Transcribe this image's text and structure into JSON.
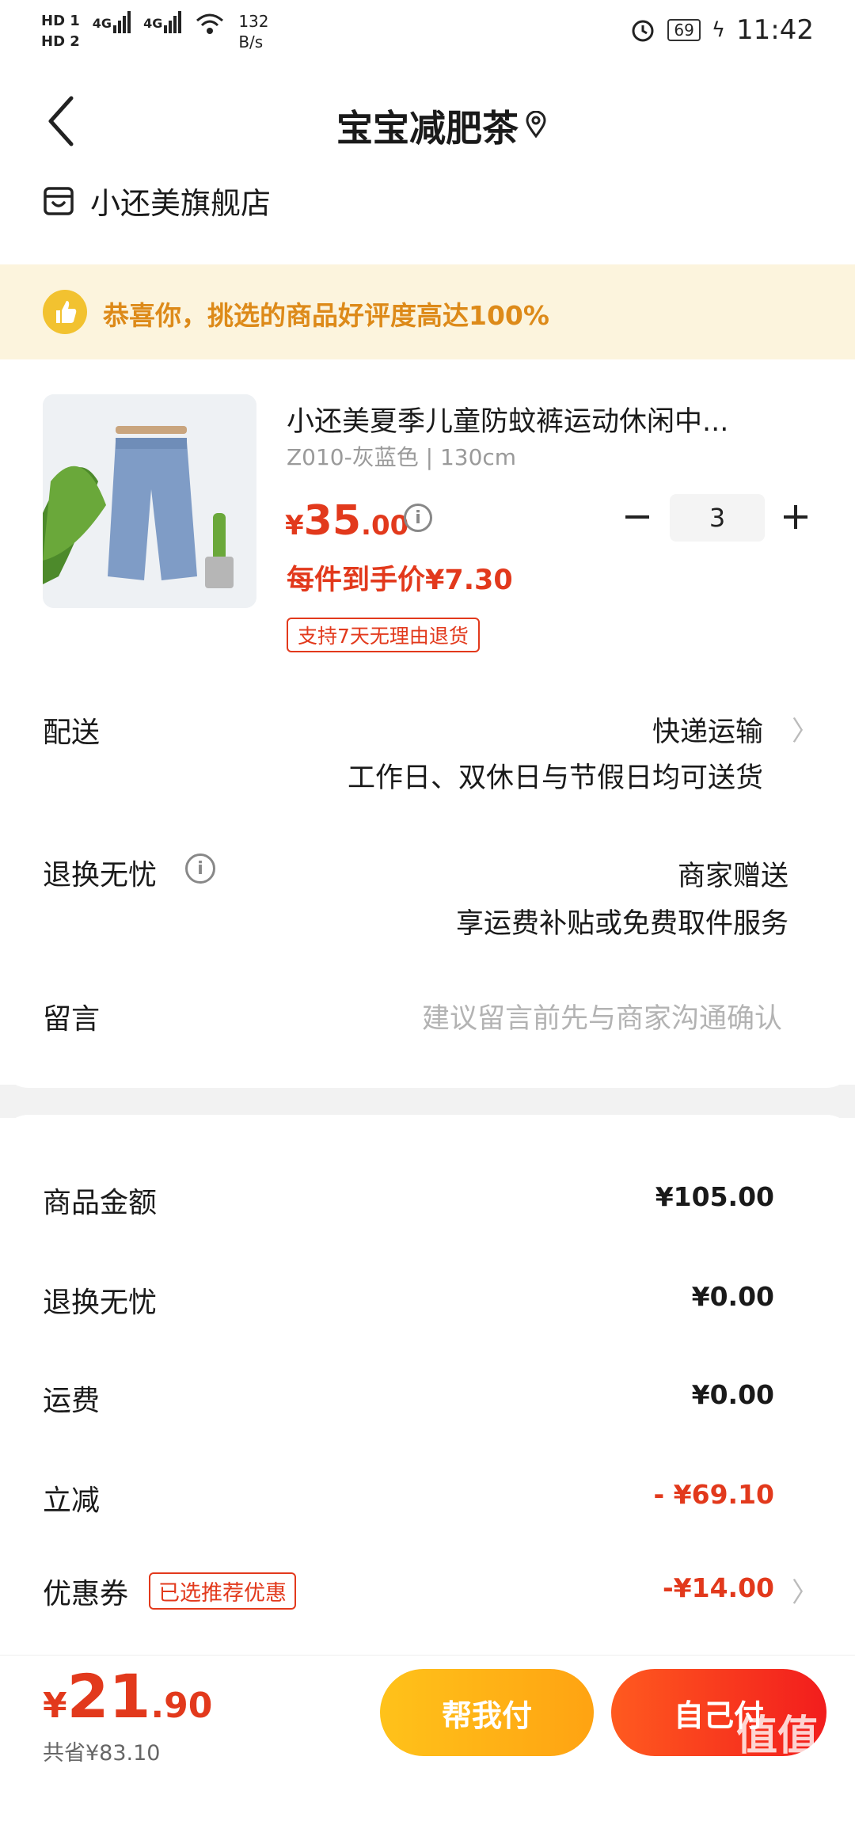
{
  "status_bar": {
    "sim1": "HD 1",
    "sim2": "HD 2",
    "net1": "4G",
    "net2": "4G",
    "speed": "132",
    "speed_unit": "B/s",
    "battery": "69",
    "time": "11:42"
  },
  "header": {
    "title": "宝宝减肥茶",
    "store_name": "小还美旗舰店"
  },
  "banner": {
    "text": "恭喜你，挑选的商品好评度高达100%"
  },
  "product": {
    "title": "小还美夏季儿童防蚊裤运动休闲中...",
    "spec": "Z010-灰蓝色 | 130cm",
    "price_yen": "¥",
    "price_int": "35",
    "price_dec": ".00",
    "unit_price": "每件到手价¥7.30",
    "return_tag": "支持7天无理由退货",
    "quantity": "3"
  },
  "rows": {
    "delivery_label": "配送",
    "delivery_value": "快递运输",
    "delivery_sub": "工作日、双休日与节假日均可送货",
    "return_label": "退换无忧",
    "return_value": "商家赠送",
    "return_sub": "享运费补贴或免费取件服务",
    "message_label": "留言",
    "message_placeholder": "建议留言前先与商家沟通确认"
  },
  "summary": {
    "goods_label": "商品金额",
    "goods_value": "¥105.00",
    "return_label": "退换无忧",
    "return_value": "¥0.00",
    "shipping_label": "运费",
    "shipping_value": "¥0.00",
    "discount_label": "立减",
    "discount_value": "- ¥69.10",
    "coupon_label": "优惠券",
    "coupon_tag": "已选推荐优惠",
    "coupon_value": "-¥14.00"
  },
  "bottom": {
    "total_yen": "¥",
    "total_int": "21",
    "total_dec": ".90",
    "saved": "共省¥83.10",
    "help_pay": "帮我付",
    "self_pay": "自己付"
  },
  "watermark": "值值值",
  "colors": {
    "accent_red": "#e2391c",
    "banner_bg": "#fcf4dd",
    "banner_text": "#dd8a19",
    "help_btn": "#ffb318",
    "self_btn": "#f5321c"
  }
}
